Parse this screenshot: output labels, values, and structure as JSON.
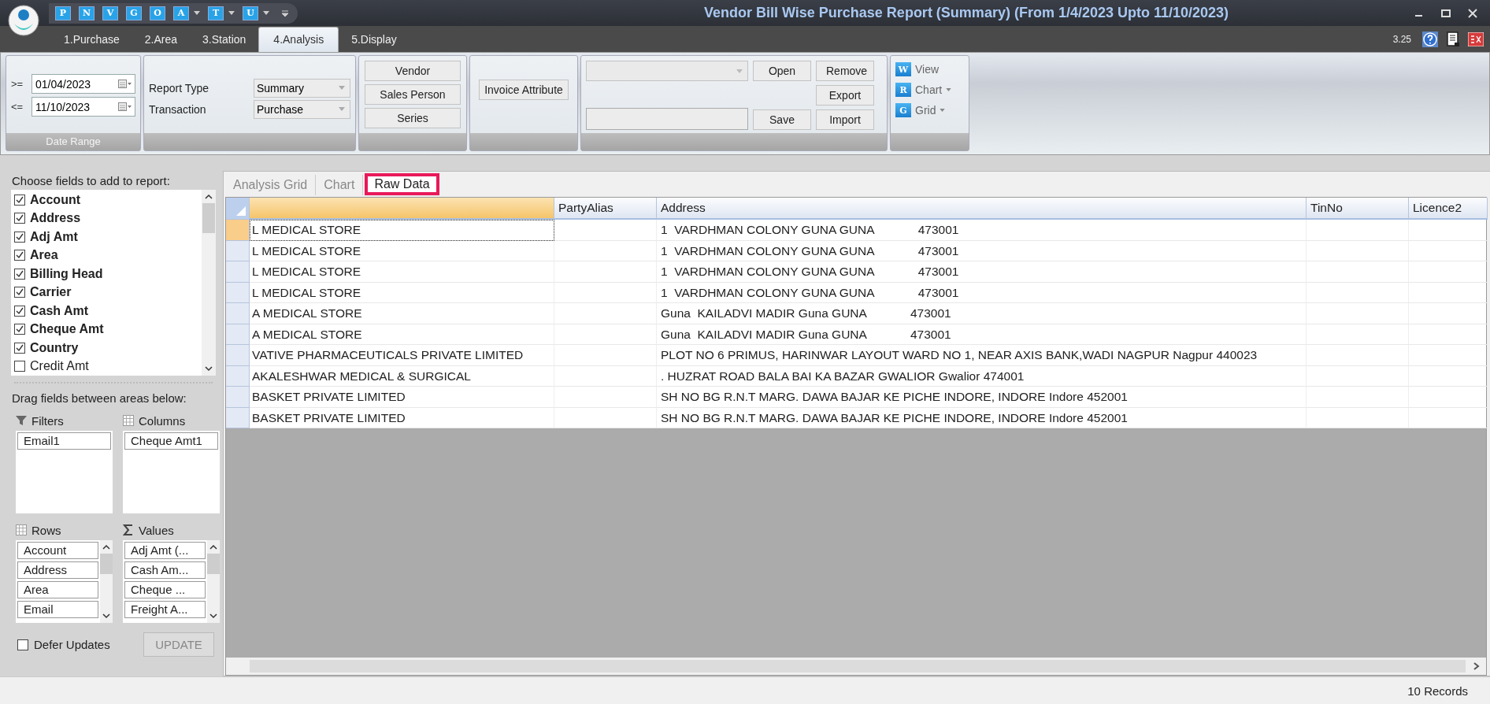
{
  "window": {
    "title": "Vendor Bill Wise Purchase Report (Summary) (From 1/4/2023 Upto 11/10/2023)"
  },
  "quick_access": [
    {
      "label": "P",
      "dropdown": false
    },
    {
      "label": "N",
      "dropdown": false
    },
    {
      "label": "V",
      "dropdown": false
    },
    {
      "label": "G",
      "dropdown": false
    },
    {
      "label": "O",
      "dropdown": false
    },
    {
      "label": "A",
      "dropdown": true
    },
    {
      "label": "T",
      "dropdown": true
    },
    {
      "label": "U",
      "dropdown": true
    }
  ],
  "ribbon_tabs": [
    {
      "label": "1.Purchase",
      "selected": false
    },
    {
      "label": "2.Area",
      "selected": false
    },
    {
      "label": "3.Station",
      "selected": false
    },
    {
      "label": "4.Analysis",
      "selected": true
    },
    {
      "label": "5.Display",
      "selected": false
    }
  ],
  "version": "3.25",
  "ribbon": {
    "date_range": {
      "title": "Date Range",
      "rows": [
        {
          "operator": ">=",
          "value": "01/04/2023"
        },
        {
          "operator": "<=",
          "value": "11/10/2023"
        }
      ]
    },
    "report_options": [
      {
        "label": "Report Type",
        "value": "Summary"
      },
      {
        "label": "Transaction",
        "value": "Purchase"
      }
    ],
    "filter_buttons": [
      "Vendor",
      "Sales Person",
      "Series"
    ],
    "attribute_button": "Invoice Attribute",
    "layout_buttons": {
      "open": "Open",
      "remove": "Remove",
      "export": "Export",
      "save": "Save",
      "import": "Import"
    },
    "view_buttons": [
      {
        "label": "View",
        "icon_text": "W",
        "dropdown": false
      },
      {
        "label": "Chart",
        "icon_text": "R",
        "dropdown": true
      },
      {
        "label": "Grid",
        "icon_text": "G",
        "dropdown": true
      }
    ]
  },
  "field_list": {
    "title": "Choose fields to add to report:",
    "items": [
      {
        "label": "Account",
        "checked": true
      },
      {
        "label": "Address",
        "checked": true
      },
      {
        "label": "Adj Amt",
        "checked": true
      },
      {
        "label": "Area",
        "checked": true
      },
      {
        "label": "Billing Head",
        "checked": true
      },
      {
        "label": "Carrier",
        "checked": true
      },
      {
        "label": "Cash Amt",
        "checked": true
      },
      {
        "label": "Cheque Amt",
        "checked": true
      },
      {
        "label": "Country",
        "checked": true
      },
      {
        "label": "Credit Amt",
        "checked": false
      }
    ]
  },
  "areas": {
    "title": "Drag fields between areas below:",
    "filters": {
      "label": "Filters",
      "items": [
        "Email1"
      ]
    },
    "columns": {
      "label": "Columns",
      "items": [
        "Cheque Amt1"
      ]
    },
    "rows": {
      "label": "Rows",
      "items": [
        "Account",
        "Address",
        "Area",
        "Email"
      ]
    },
    "values": {
      "label": "Values",
      "items": [
        "Adj Amt (...",
        "Cash Am...",
        "Cheque ...",
        "Freight A..."
      ]
    }
  },
  "defer_updates": {
    "label": "Defer Updates",
    "checked": false
  },
  "update_button": "UPDATE",
  "content_tabs": [
    {
      "label": "Analysis Grid",
      "selected": false
    },
    {
      "label": "Chart",
      "selected": false
    },
    {
      "label": "Raw Data",
      "selected": true
    }
  ],
  "table": {
    "columns": [
      {
        "selected": true
      },
      {
        "label": "PartyAlias",
        "selected": false
      },
      {
        "label": "Address",
        "selected": false
      },
      {
        "label": "TinNo",
        "selected": false
      },
      {
        "label": "Licence2",
        "selected": false
      }
    ],
    "rows": [
      {
        "selected": true,
        "column_1": "L MEDICAL STORE",
        "address": "1  VARDHMAN COLONY GUNA GUNA             473001"
      },
      {
        "selected": false,
        "column_1": "L MEDICAL STORE",
        "address": "1  VARDHMAN COLONY GUNA GUNA             473001"
      },
      {
        "selected": false,
        "column_1": "L MEDICAL STORE",
        "address": "1  VARDHMAN COLONY GUNA GUNA             473001"
      },
      {
        "selected": false,
        "column_1": "L MEDICAL STORE",
        "address": "1  VARDHMAN COLONY GUNA GUNA             473001"
      },
      {
        "selected": false,
        "column_1": "A MEDICAL STORE",
        "address": "Guna  KAILADVI MADIR Guna GUNA             473001"
      },
      {
        "selected": false,
        "column_1": "A MEDICAL STORE",
        "address": "Guna  KAILADVI MADIR Guna GUNA             473001"
      },
      {
        "selected": false,
        "column_1": "VATIVE PHARMACEUTICALS PRIVATE LIMITED",
        "address": "PLOT NO 6 PRIMUS, HARINWAR LAYOUT WARD NO 1, NEAR AXIS BANK,WADI NAGPUR Nagpur 440023"
      },
      {
        "selected": false,
        "column_1": "AKALESHWAR MEDICAL & SURGICAL",
        "address": ". HUZRAT ROAD BALA BAI KA BAZAR GWALIOR Gwalior 474001"
      },
      {
        "selected": false,
        "column_1": "BASKET PRIVATE LIMITED",
        "address": "SH NO BG R.N.T MARG. DAWA BAJAR KE PICHE INDORE, INDORE Indore 452001"
      },
      {
        "selected": false,
        "column_1": "BASKET PRIVATE LIMITED",
        "address": "SH NO BG R.N.T MARG. DAWA BAJAR KE PICHE INDORE, INDORE Indore 452001"
      }
    ]
  },
  "status_bar": "10 Records"
}
